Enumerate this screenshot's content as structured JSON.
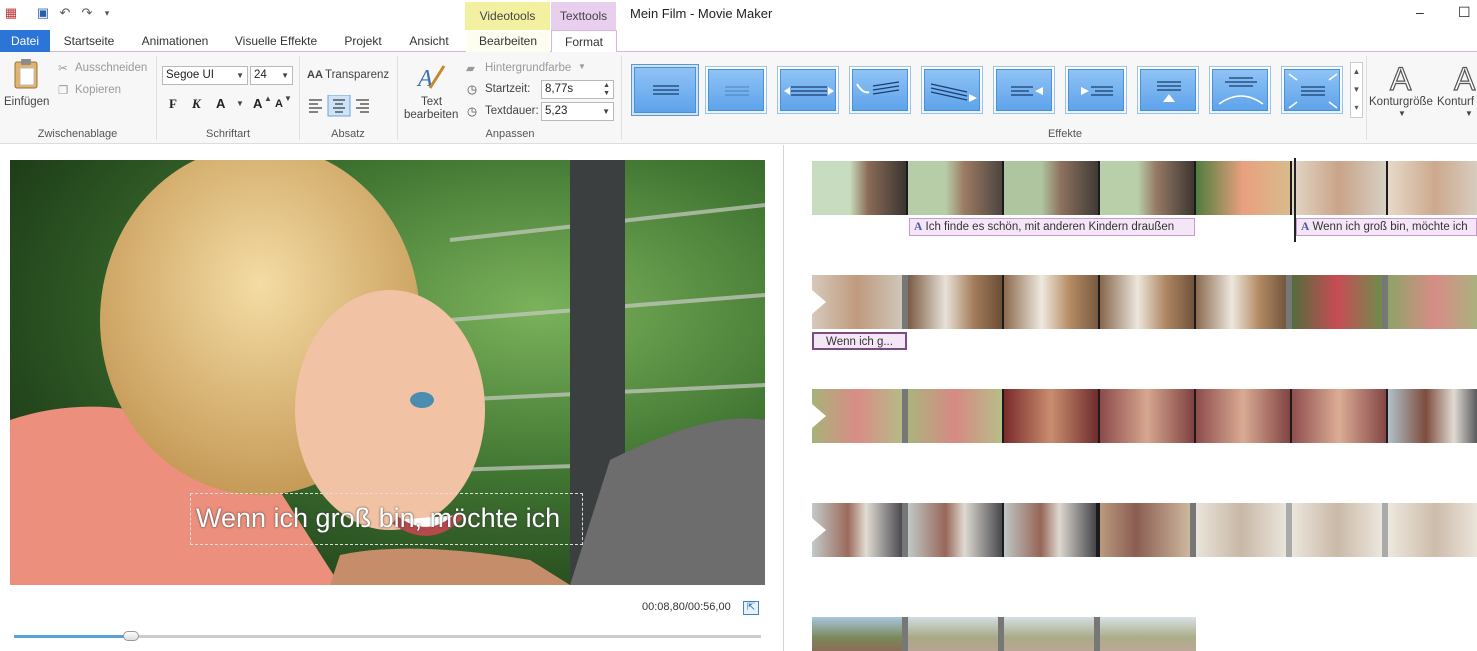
{
  "window": {
    "title": "Mein Film - Movie Maker",
    "minimize": "–",
    "maximize": "☐"
  },
  "context_tabs": {
    "video": "Videotools",
    "text": "Texttools"
  },
  "tabs": [
    {
      "label": "Datei"
    },
    {
      "label": "Startseite"
    },
    {
      "label": "Animationen"
    },
    {
      "label": "Visuelle Effekte"
    },
    {
      "label": "Projekt"
    },
    {
      "label": "Ansicht"
    },
    {
      "label": "Bearbeiten"
    },
    {
      "label": "Format"
    }
  ],
  "ribbon": {
    "clipboard": {
      "paste": "Einfügen",
      "cut": "Ausschneiden",
      "copy": "Kopieren",
      "label": "Zwischenablage"
    },
    "font": {
      "family": "Segoe UI",
      "size": "24",
      "bold": "F",
      "italic": "K",
      "color": "A",
      "grow": "A",
      "shrink": "A",
      "label": "Schriftart"
    },
    "paragraph": {
      "transparency": "Transparenz",
      "label": "Absatz"
    },
    "adjust": {
      "edit_text_1": "Text",
      "edit_text_2": "bearbeiten",
      "background_color": "Hintergrundfarbe",
      "start_time_label": "Startzeit:",
      "start_time": "8,77s",
      "duration_label": "Textdauer:",
      "duration": "5,23",
      "label": "Anpassen"
    },
    "effects": {
      "label": "Effekte",
      "outline_size": "Konturgröße",
      "outline_color": "Konturf"
    }
  },
  "preview": {
    "caption": "Wenn ich groß bin, möchte ich",
    "timecode": "00:08,80/00:56,00",
    "progress": 0.157
  },
  "timeline": {
    "captions": [
      {
        "text": "Ich finde es schön, mit anderen Kindern draußen"
      },
      {
        "text": "Wenn ich groß bin, möchte ich"
      },
      {
        "text": "Wenn ich g..."
      }
    ]
  },
  "colors": {
    "accent": "#2b74d8",
    "video_tools": "#f3f1a1",
    "text_tools": "#e9cfee",
    "caption_bg": "#f5e6f7"
  }
}
